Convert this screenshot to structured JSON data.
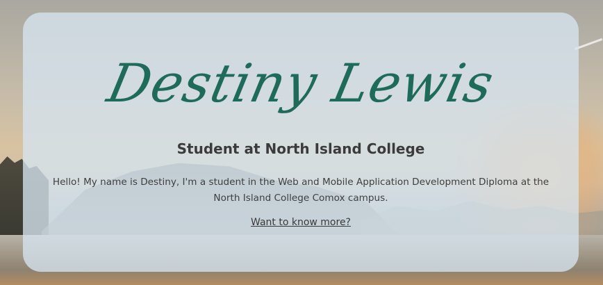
{
  "hero": {
    "name": "Destiny Lewis",
    "subtitle": "Student at North Island College",
    "intro": "Hello! My name is Destiny, I'm a student in the Web and Mobile Application Development Diploma at the North Island College Comox campus.",
    "more_link": "Want to know more?"
  },
  "colors": {
    "name": "#1f6b5b",
    "card": "#d6e4f0",
    "text": "#3b3b3b"
  }
}
